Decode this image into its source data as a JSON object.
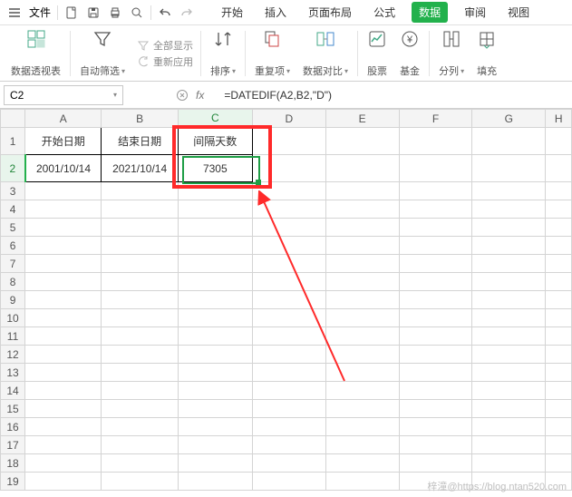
{
  "menubar": {
    "file": "文件"
  },
  "tabs": {
    "start": "开始",
    "insert": "插入",
    "layout": "页面布局",
    "formula": "公式",
    "data": "数据",
    "review": "审阅",
    "view": "视图"
  },
  "ribbon": {
    "pivot": "数据透视表",
    "autofilter": "自动筛选",
    "show_all": "全部显示",
    "reapply": "重新应用",
    "sort": "排序",
    "dedup": "重复项",
    "compare": "数据对比",
    "stocks": "股票",
    "funds": "基金",
    "split": "分列",
    "fill": "填充"
  },
  "namebox": {
    "value": "C2"
  },
  "formula_bar": {
    "text": "=DATEDIF(A2,B2,\"D\")"
  },
  "columns": [
    "A",
    "B",
    "C",
    "D",
    "E",
    "F",
    "G",
    "H"
  ],
  "rows": [
    "1",
    "2",
    "3",
    "4",
    "5",
    "6",
    "7",
    "8",
    "9",
    "10",
    "11",
    "12",
    "13",
    "14",
    "15",
    "16",
    "17",
    "18",
    "19"
  ],
  "headers": {
    "A1": "开始日期",
    "B1": "结束日期",
    "C1": "间隔天数"
  },
  "data": {
    "A2": "2001/10/14",
    "B2": "2021/10/14",
    "C2": "7305"
  },
  "watermark": "梓潼@https://blog.ntan520.com"
}
